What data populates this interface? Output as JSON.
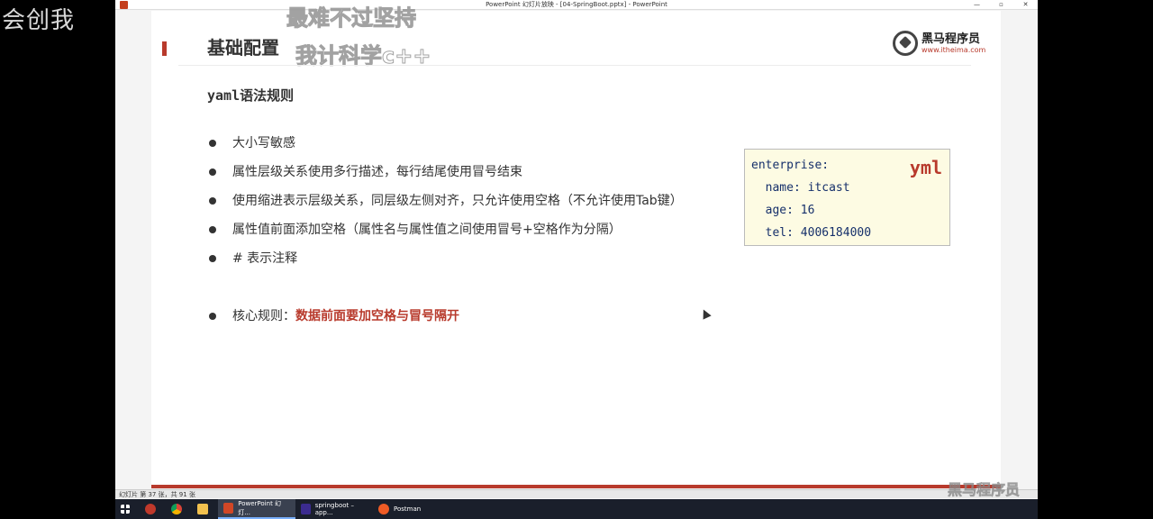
{
  "overlay": {
    "left_watermark": "会创我",
    "slide_watermark_1": "最难不过坚持",
    "slide_watermark_2": "我计科学c++",
    "status_watermark": "黑马程序员"
  },
  "window": {
    "title": "PowerPoint 幻灯片放映 - [04-SpringBoot.pptx] - PowerPoint",
    "controls": [
      "—",
      "▫",
      "✕"
    ]
  },
  "slide": {
    "title": "基础配置",
    "logo": {
      "brand": "黑马程序员",
      "url": "www.itheima.com"
    },
    "subtitle_code": "yaml",
    "subtitle_text": "语法规则",
    "bullets": [
      "大小写敏感",
      "属性层级关系使用多行描述，每行结尾使用冒号结束",
      "使用缩进表示层级关系，同层级左侧对齐，只允许使用空格（不允许使用Tab键）",
      "属性值前面添加空格（属性名与属性值之间使用冒号+空格作为分隔）",
      "#  表示注释"
    ],
    "key_rule": {
      "label": "核心规则：",
      "highlight": "数据前面要加空格与冒号隔开"
    },
    "code": {
      "tag": "yml",
      "lines": [
        "enterprise:",
        "  name: itcast",
        "  age: 16",
        "  tel: 4006184000"
      ]
    },
    "colors": {
      "accent": "#b83a2c",
      "code_bg": "#fdfbe3",
      "code_text": "#16306b"
    }
  },
  "statusbar": {
    "slide_count": "幻灯片 第 37 张，共 91 张"
  },
  "taskbar": {
    "apps": [
      {
        "label": "PowerPoint 幻灯...",
        "icon": "powerpoint-icon"
      },
      {
        "label": "springboot – app...",
        "icon": "intellij-icon"
      },
      {
        "label": "Postman",
        "icon": "postman-icon"
      }
    ]
  }
}
